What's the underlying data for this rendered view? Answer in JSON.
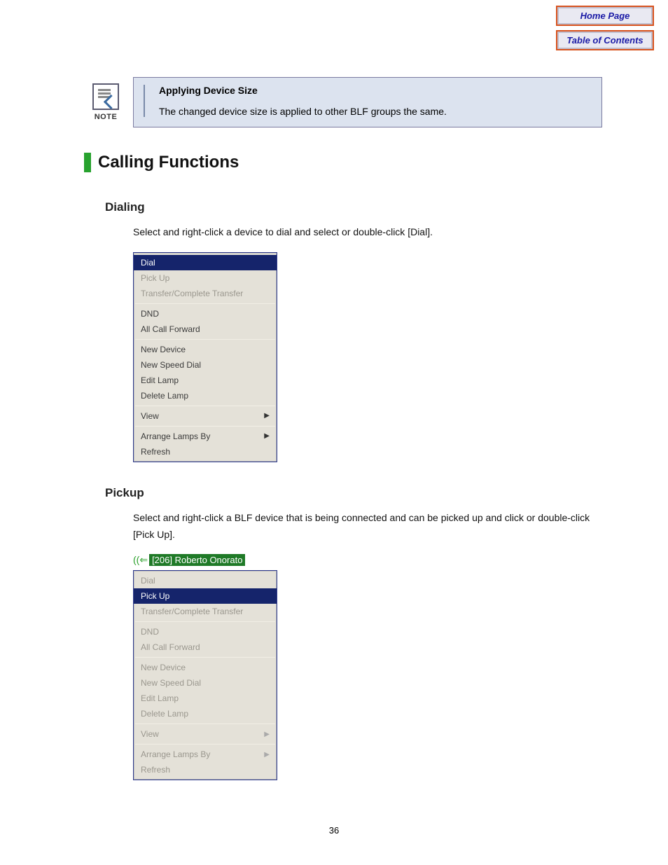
{
  "nav": {
    "home": "Home Page",
    "toc": "Table of Contents"
  },
  "note": {
    "label": "NOTE",
    "title": "Applying Device Size",
    "body": "The changed device size is applied to other BLF groups the same."
  },
  "section_heading": "Calling Functions",
  "dialing": {
    "heading": "Dialing",
    "body": "Select and right-click a device to dial and select or double-click [Dial].",
    "menu": {
      "items": {
        "dial": "Dial",
        "pickup": "Pick Up",
        "transfer": "Transfer/Complete Transfer",
        "dnd": "DND",
        "allcf": "All Call Forward",
        "newdev": "New Device",
        "newspd": "New Speed Dial",
        "editl": "Edit Lamp",
        "dell": "Delete Lamp",
        "view": "View",
        "arrange": "Arrange Lamps By",
        "refresh": "Refresh"
      }
    }
  },
  "pickup": {
    "heading": "Pickup",
    "body": "Select and right-click a BLF device that is being connected and can be picked up and click or double-click [Pick Up].",
    "blf_label": "[206] Roberto Onorato",
    "menu": {
      "items": {
        "dial": "Dial",
        "pickup": "Pick Up",
        "transfer": "Transfer/Complete Transfer",
        "dnd": "DND",
        "allcf": "All Call Forward",
        "newdev": "New Device",
        "newspd": "New Speed Dial",
        "editl": "Edit Lamp",
        "dell": "Delete Lamp",
        "view": "View",
        "arrange": "Arrange Lamps By",
        "refresh": "Refresh"
      }
    }
  },
  "page_number": "36"
}
